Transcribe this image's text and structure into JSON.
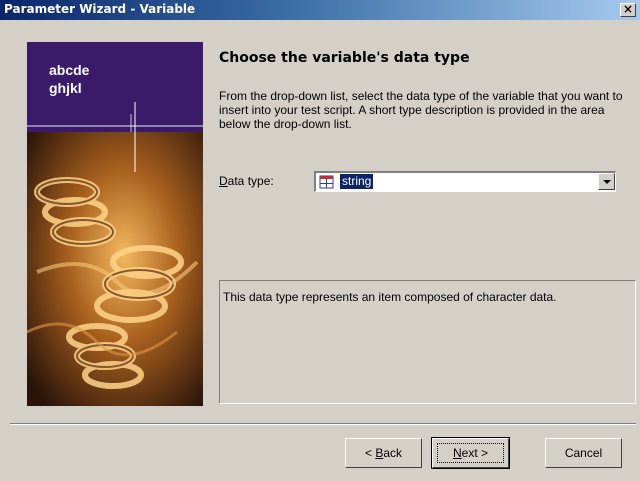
{
  "window": {
    "title": "Parameter Wizard - Variable",
    "close_label": "×"
  },
  "side_image": {
    "line1": "abcde",
    "line2": "ghjkl"
  },
  "page": {
    "heading": "Choose the variable's data type",
    "description": "From the drop-down list, select the data type of the variable that you want to insert into your test script. A short type description is provided in the area below the drop-down list."
  },
  "data_type": {
    "label_accel": "D",
    "label_rest": "ata type:",
    "selected_value": "string",
    "icon": "type-icon"
  },
  "type_description": {
    "text": "This data type represents an item composed of character data."
  },
  "buttons": {
    "back_prefix": "< ",
    "back_accel": "B",
    "back_rest": "ack",
    "next_accel": "N",
    "next_rest": "ext >",
    "cancel": "Cancel"
  },
  "colors": {
    "title_gradient_start": "#0a246a",
    "title_gradient_end": "#a6caf0",
    "dialog_bg": "#d4d0c8",
    "selection_bg": "#0a246a",
    "side_top": "#3b1a6a"
  }
}
